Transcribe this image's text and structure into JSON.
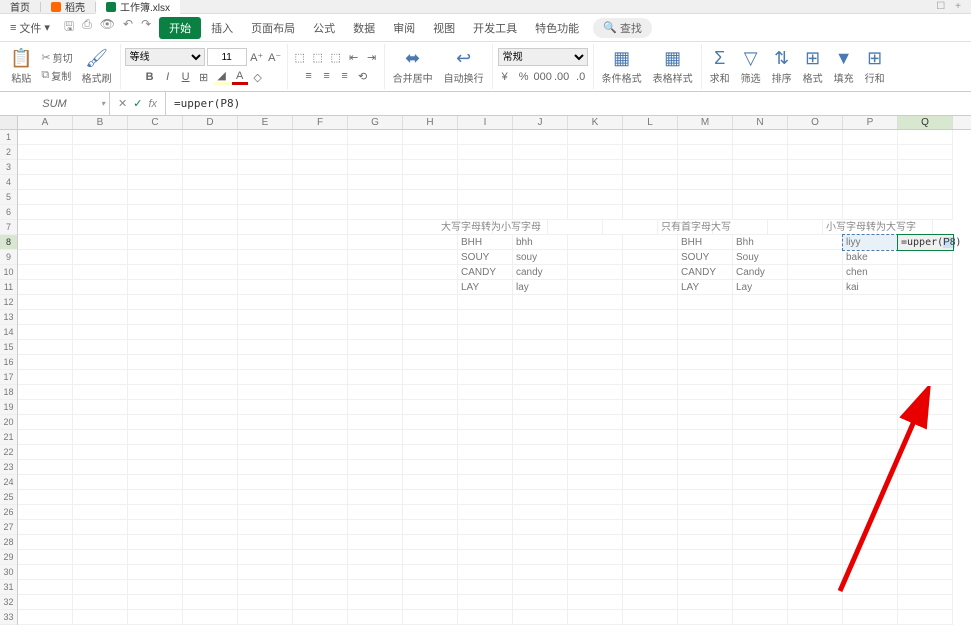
{
  "tabs": {
    "home": "首页",
    "dk": "稻壳",
    "workbook": "工作簿.xlsx"
  },
  "menu": {
    "file": "文件",
    "start": "开始",
    "insert": "插入",
    "page_layout": "页面布局",
    "formula": "公式",
    "data": "数据",
    "review": "审阅",
    "view": "视图",
    "dev": "开发工具",
    "special": "特色功能",
    "search": "查找"
  },
  "ribbon": {
    "paste": "粘贴",
    "cut": "剪切",
    "copy": "复制",
    "format_painter": "格式刷",
    "font_name": "等线",
    "font_size": "11",
    "merge": "合并居中",
    "wrap": "自动换行",
    "number_format": "常规",
    "cond_fmt": "条件格式",
    "table_style": "表格样式",
    "sum": "求和",
    "filter": "筛选",
    "sort": "排序",
    "format": "格式",
    "fill": "填充",
    "row_col": "行和"
  },
  "formula_bar": {
    "name": "SUM",
    "formula": "=upper(P8)"
  },
  "columns": [
    "A",
    "B",
    "C",
    "D",
    "E",
    "F",
    "G",
    "H",
    "I",
    "J",
    "K",
    "L",
    "M",
    "N",
    "O",
    "P",
    "Q"
  ],
  "rows": 33,
  "active_row": 8,
  "active_col": "Q",
  "data": {
    "headers": {
      "lower_title": "大写字母转为小写字母",
      "proper_title": "只有首字母大写",
      "upper_title": "小写字母转为大写字"
    },
    "lower_section": [
      {
        "in": "BHH",
        "out": "bhh"
      },
      {
        "in": "SOUY",
        "out": "souy"
      },
      {
        "in": "CANDY",
        "out": "candy"
      },
      {
        "in": "LAY",
        "out": "lay"
      }
    ],
    "proper_section": [
      {
        "in": "BHH",
        "out": "Bhh"
      },
      {
        "in": "SOUY",
        "out": "Souy"
      },
      {
        "in": "CANDY",
        "out": "Candy"
      },
      {
        "in": "LAY",
        "out": "Lay"
      }
    ],
    "upper_section": [
      {
        "in": "liyy",
        "out_formula": "=upper(",
        "out_ref": "P8",
        "out_tail": ")"
      },
      {
        "in": "bake"
      },
      {
        "in": "chen"
      },
      {
        "in": "kai"
      }
    ]
  }
}
